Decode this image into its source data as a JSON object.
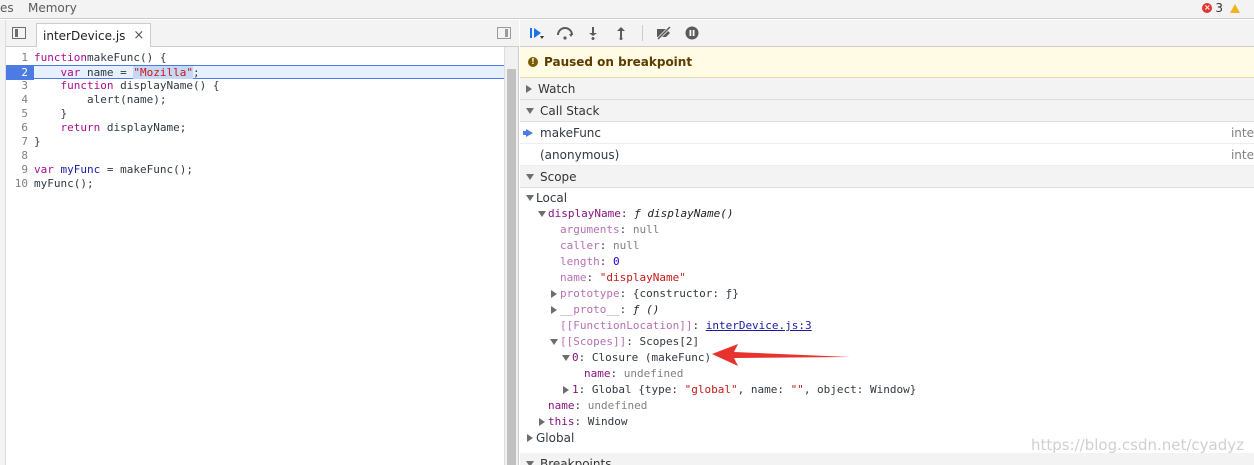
{
  "top_tabs": {
    "left_partial": "es",
    "memory": "Memory"
  },
  "status": {
    "errors": "3"
  },
  "editor": {
    "file_tab": "interDevice.js",
    "close": "×",
    "lines": [
      {
        "n": "1",
        "parts": [
          [
            "kw",
            "function"
          ],
          [
            "",
            "makeFunc() {"
          ]
        ]
      },
      {
        "n": "2",
        "parts": [
          [
            "",
            "    "
          ],
          [
            "kw",
            "var"
          ],
          [
            "",
            " name = "
          ],
          [
            "str",
            "\"Mozilla\""
          ],
          [
            "",
            ";"
          ]
        ],
        "exec": true
      },
      {
        "n": "3",
        "parts": [
          [
            "",
            "    "
          ],
          [
            "kw",
            "function"
          ],
          [
            "",
            " displayName() {"
          ]
        ]
      },
      {
        "n": "4",
        "parts": [
          [
            "",
            "        alert(name);"
          ]
        ]
      },
      {
        "n": "5",
        "parts": [
          [
            "",
            "    }"
          ]
        ]
      },
      {
        "n": "6",
        "parts": [
          [
            "",
            "    "
          ],
          [
            "kw",
            "return"
          ],
          [
            "",
            " displayName;"
          ]
        ]
      },
      {
        "n": "7",
        "parts": [
          [
            "",
            "}"
          ]
        ]
      },
      {
        "n": "8",
        "parts": [
          [
            "",
            ""
          ]
        ]
      },
      {
        "n": "9",
        "parts": [
          [
            "kw",
            "var"
          ],
          [
            "ident",
            " myFunc"
          ],
          [
            "",
            " = makeFunc();"
          ]
        ]
      },
      {
        "n": "10",
        "parts": [
          [
            "",
            "myFunc();"
          ]
        ]
      }
    ]
  },
  "toolbar": {
    "resume_icon": "resume-icon",
    "step_over_icon": "step-over-icon",
    "step_into_icon": "step-into-icon",
    "step_out_icon": "step-out-icon",
    "deactivate_icon": "deactivate-breakpoints-icon",
    "pause_exceptions_icon": "pause-on-exceptions-icon"
  },
  "paused": {
    "text": "Paused on breakpoint"
  },
  "sections": {
    "watch": "Watch",
    "call_stack": "Call Stack",
    "scope": "Scope",
    "breakpoints": "Breakpoints"
  },
  "call_stack": [
    {
      "name": "makeFunc",
      "loc": "inte",
      "current": true
    },
    {
      "name": "(anonymous)",
      "loc": "inte",
      "current": false
    }
  ],
  "scope": {
    "local": "Local",
    "display_name_key": "displayName",
    "display_name_val": "ƒ displayName()",
    "arguments_key": "arguments",
    "arguments_val": "null",
    "caller_key": "caller",
    "caller_val": "null",
    "length_key": "length",
    "length_val": "0",
    "name_key": "name",
    "name_val": "\"displayName\"",
    "prototype_key": "prototype",
    "prototype_val": "{constructor: ƒ}",
    "proto_key": "__proto__",
    "proto_val": "ƒ ()",
    "fnloc_key": "[[FunctionLocation]]",
    "fnloc_val": "interDevice.js:3",
    "scopes_key": "[[Scopes]]",
    "scopes_val": "Scopes[2]",
    "closure_key": "0",
    "closure_val": "Closure (makeFunc)",
    "closure_name_key": "name",
    "closure_name_val": "undefined",
    "global_idx_key": "1",
    "global_idx_val_pre": "Global {type: ",
    "global_idx_type": "\"global\"",
    "global_idx_mid": ", name: ",
    "global_idx_name": "\"\"",
    "global_idx_post": ", object: Window}",
    "local_name_key": "name",
    "local_name_val": "undefined",
    "this_key": "this",
    "this_val": "Window",
    "global": "Global"
  },
  "watermark": "https://blog.csdn.net/cyadyz",
  "colors": {
    "accent": "#4d7be4",
    "annotation_arrow": "#e8322d",
    "paused_bg": "#fffbe5"
  }
}
